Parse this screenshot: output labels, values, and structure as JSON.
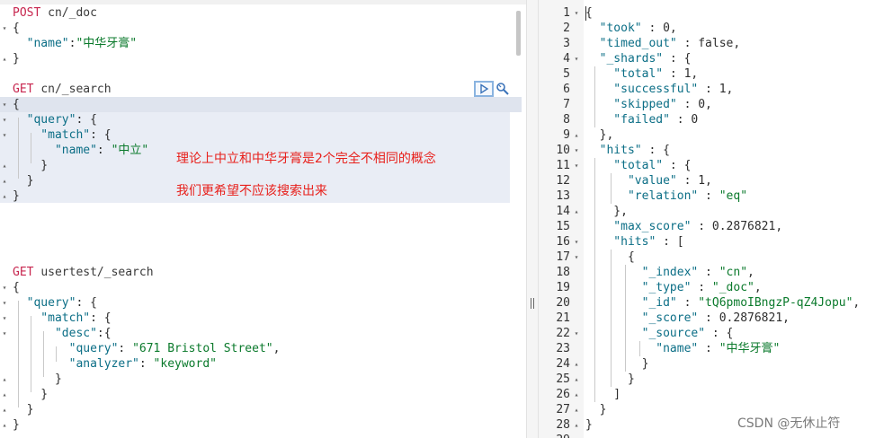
{
  "request_editor": {
    "requests": [
      {
        "lines": [
          [
            {
              "t": "POST ",
              "c": "method"
            },
            {
              "t": "cn/_doc",
              "c": "url"
            }
          ],
          [
            {
              "t": "{",
              "c": "punc"
            }
          ],
          [
            {
              "t": "  \"name\"",
              "c": "key"
            },
            {
              "t": ":",
              "c": "punc"
            },
            {
              "t": "\"中华牙膏\"",
              "c": "str"
            }
          ],
          [
            {
              "t": "}",
              "c": "punc"
            }
          ]
        ]
      },
      {
        "lines": [
          [
            {
              "t": "GET ",
              "c": "method"
            },
            {
              "t": "cn/_search",
              "c": "url"
            }
          ],
          [
            {
              "t": "{",
              "c": "punc"
            }
          ],
          [
            {
              "t": "  \"query\"",
              "c": "key"
            },
            {
              "t": ": {",
              "c": "punc"
            }
          ],
          [
            {
              "t": "    \"match\"",
              "c": "key"
            },
            {
              "t": ": {",
              "c": "punc"
            }
          ],
          [
            {
              "t": "      \"name\"",
              "c": "key"
            },
            {
              "t": ": ",
              "c": "punc"
            },
            {
              "t": "\"中立\"",
              "c": "str"
            }
          ],
          [
            {
              "t": "    }",
              "c": "punc"
            }
          ],
          [
            {
              "t": "  }",
              "c": "punc"
            }
          ],
          [
            {
              "t": "}",
              "c": "punc"
            }
          ]
        ]
      },
      {
        "lines": [
          [
            {
              "t": "GET ",
              "c": "method"
            },
            {
              "t": "usertest/_search",
              "c": "url"
            }
          ],
          [
            {
              "t": "{",
              "c": "punc"
            }
          ],
          [
            {
              "t": "  \"query\"",
              "c": "key"
            },
            {
              "t": ": {",
              "c": "punc"
            }
          ],
          [
            {
              "t": "    \"match\"",
              "c": "key"
            },
            {
              "t": ": {",
              "c": "punc"
            }
          ],
          [
            {
              "t": "      \"desc\"",
              "c": "key"
            },
            {
              "t": ":{",
              "c": "punc"
            }
          ],
          [
            {
              "t": "        \"query\"",
              "c": "key"
            },
            {
              "t": ": ",
              "c": "punc"
            },
            {
              "t": "\"671 Bristol Street\"",
              "c": "str"
            },
            {
              "t": ",",
              "c": "punc"
            }
          ],
          [
            {
              "t": "        \"analyzer\"",
              "c": "key"
            },
            {
              "t": ": ",
              "c": "punc"
            },
            {
              "t": "\"keyword\"",
              "c": "str"
            }
          ],
          [
            {
              "t": "      }",
              "c": "punc"
            }
          ],
          [
            {
              "t": "    }",
              "c": "punc"
            }
          ],
          [
            {
              "t": "  }",
              "c": "punc"
            }
          ],
          [
            {
              "t": "}",
              "c": "punc"
            }
          ]
        ]
      }
    ],
    "run_icon": "play-icon",
    "settings_icon": "wrench-icon"
  },
  "annotations": {
    "line1": "理论上中立和中华牙膏是2个完全不相同的概念",
    "line2": "我们更希望不应该搜索出来",
    "color": "#e8201b"
  },
  "response_viewer": {
    "lines": [
      {
        "n": "1",
        "f": "▾",
        "p": [
          {
            "t": "{",
            "c": "rnum"
          }
        ]
      },
      {
        "n": "2",
        "f": "",
        "p": [
          {
            "t": "  \"took\"",
            "c": "rkey"
          },
          {
            "t": " : 0,",
            "c": "rnum"
          }
        ]
      },
      {
        "n": "3",
        "f": "",
        "p": [
          {
            "t": "  \"timed_out\"",
            "c": "rkey"
          },
          {
            "t": " : false,",
            "c": "rnum"
          }
        ]
      },
      {
        "n": "4",
        "f": "▾",
        "p": [
          {
            "t": "  \"_shards\"",
            "c": "rkey"
          },
          {
            "t": " : {",
            "c": "rnum"
          }
        ]
      },
      {
        "n": "5",
        "f": "",
        "p": [
          {
            "t": "    \"total\"",
            "c": "rkey"
          },
          {
            "t": " : 1,",
            "c": "rnum"
          }
        ]
      },
      {
        "n": "6",
        "f": "",
        "p": [
          {
            "t": "    \"successful\"",
            "c": "rkey"
          },
          {
            "t": " : 1,",
            "c": "rnum"
          }
        ]
      },
      {
        "n": "7",
        "f": "",
        "p": [
          {
            "t": "    \"skipped\"",
            "c": "rkey"
          },
          {
            "t": " : 0,",
            "c": "rnum"
          }
        ]
      },
      {
        "n": "8",
        "f": "",
        "p": [
          {
            "t": "    \"failed\"",
            "c": "rkey"
          },
          {
            "t": " : 0",
            "c": "rnum"
          }
        ]
      },
      {
        "n": "9",
        "f": "▴",
        "p": [
          {
            "t": "  },",
            "c": "rnum"
          }
        ]
      },
      {
        "n": "10",
        "f": "▾",
        "p": [
          {
            "t": "  \"hits\"",
            "c": "rkey"
          },
          {
            "t": " : {",
            "c": "rnum"
          }
        ]
      },
      {
        "n": "11",
        "f": "▾",
        "p": [
          {
            "t": "    \"total\"",
            "c": "rkey"
          },
          {
            "t": " : {",
            "c": "rnum"
          }
        ]
      },
      {
        "n": "12",
        "f": "",
        "p": [
          {
            "t": "      \"value\"",
            "c": "rkey"
          },
          {
            "t": " : 1,",
            "c": "rnum"
          }
        ]
      },
      {
        "n": "13",
        "f": "",
        "p": [
          {
            "t": "      \"relation\"",
            "c": "rkey"
          },
          {
            "t": " : ",
            "c": "rnum"
          },
          {
            "t": "\"eq\"",
            "c": "rstr"
          }
        ]
      },
      {
        "n": "14",
        "f": "▴",
        "p": [
          {
            "t": "    },",
            "c": "rnum"
          }
        ]
      },
      {
        "n": "15",
        "f": "",
        "p": [
          {
            "t": "    \"max_score\"",
            "c": "rkey"
          },
          {
            "t": " : 0.2876821,",
            "c": "rnum"
          }
        ]
      },
      {
        "n": "16",
        "f": "▾",
        "p": [
          {
            "t": "    \"hits\"",
            "c": "rkey"
          },
          {
            "t": " : [",
            "c": "rnum"
          }
        ]
      },
      {
        "n": "17",
        "f": "▾",
        "p": [
          {
            "t": "      {",
            "c": "rnum"
          }
        ]
      },
      {
        "n": "18",
        "f": "",
        "p": [
          {
            "t": "        \"_index\"",
            "c": "rkey"
          },
          {
            "t": " : ",
            "c": "rnum"
          },
          {
            "t": "\"cn\"",
            "c": "rstr"
          },
          {
            "t": ",",
            "c": "rnum"
          }
        ]
      },
      {
        "n": "19",
        "f": "",
        "p": [
          {
            "t": "        \"_type\"",
            "c": "rkey"
          },
          {
            "t": " : ",
            "c": "rnum"
          },
          {
            "t": "\"_doc\"",
            "c": "rstr"
          },
          {
            "t": ",",
            "c": "rnum"
          }
        ]
      },
      {
        "n": "20",
        "f": "",
        "p": [
          {
            "t": "        \"_id\"",
            "c": "rkey"
          },
          {
            "t": " : ",
            "c": "rnum"
          },
          {
            "t": "\"tQ6pmoIBngzP-qZ4Jopu\"",
            "c": "rstr"
          },
          {
            "t": ",",
            "c": "rnum"
          }
        ]
      },
      {
        "n": "21",
        "f": "",
        "p": [
          {
            "t": "        \"_score\"",
            "c": "rkey"
          },
          {
            "t": " : 0.2876821,",
            "c": "rnum"
          }
        ]
      },
      {
        "n": "22",
        "f": "▾",
        "p": [
          {
            "t": "        \"_source\"",
            "c": "rkey"
          },
          {
            "t": " : {",
            "c": "rnum"
          }
        ]
      },
      {
        "n": "23",
        "f": "",
        "p": [
          {
            "t": "          \"name\"",
            "c": "rkey"
          },
          {
            "t": " : ",
            "c": "rnum"
          },
          {
            "t": "\"中华牙膏\"",
            "c": "rstr"
          }
        ]
      },
      {
        "n": "24",
        "f": "▴",
        "p": [
          {
            "t": "        }",
            "c": "rnum"
          }
        ]
      },
      {
        "n": "25",
        "f": "▴",
        "p": [
          {
            "t": "      }",
            "c": "rnum"
          }
        ]
      },
      {
        "n": "26",
        "f": "▴",
        "p": [
          {
            "t": "    ]",
            "c": "rnum"
          }
        ]
      },
      {
        "n": "27",
        "f": "▴",
        "p": [
          {
            "t": "  }",
            "c": "rnum"
          }
        ]
      },
      {
        "n": "28",
        "f": "▴",
        "p": [
          {
            "t": "}",
            "c": "rnum"
          }
        ]
      },
      {
        "n": "29",
        "f": "",
        "p": []
      }
    ]
  },
  "watermark": "CSDN @无休止符"
}
